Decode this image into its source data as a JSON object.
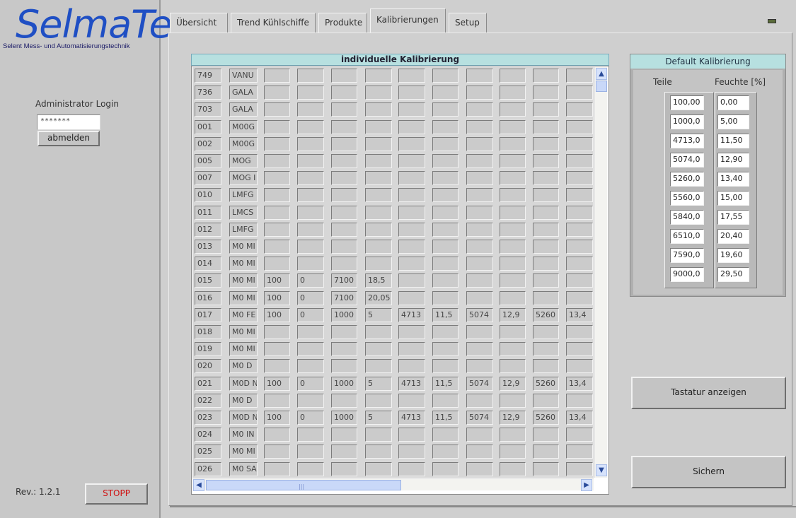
{
  "brand": {
    "logo_text": "SelmaTec",
    "subtitle": "Selent Mess- und Automatisierungstechnik",
    "logo_color": "#1f4fc4"
  },
  "sidebar": {
    "admin_label": "Administrator Login",
    "password_value": "*******",
    "logout_label": "abmelden",
    "revision": "Rev.: 1.2.1",
    "stop_label": "STOPP",
    "stop_color": "#d01010"
  },
  "tabs": [
    {
      "label": "Übersicht",
      "active": false
    },
    {
      "label": "Trend Kühlschiffe",
      "active": false
    },
    {
      "label": "Produkte",
      "active": false
    },
    {
      "label": "Kalibrierungen",
      "active": true
    },
    {
      "label": "Setup",
      "active": false
    }
  ],
  "table": {
    "title": "individuelle Kalibrierung",
    "header_color": "#b7e0e0",
    "rows": [
      [
        "749",
        "VANU",
        "",
        "",
        "",
        "",
        "",
        "",
        "",
        "",
        "",
        ""
      ],
      [
        "736",
        "GALA",
        "",
        "",
        "",
        "",
        "",
        "",
        "",
        "",
        "",
        ""
      ],
      [
        "703",
        "GALA",
        "",
        "",
        "",
        "",
        "",
        "",
        "",
        "",
        "",
        ""
      ],
      [
        "001",
        "M00G",
        "",
        "",
        "",
        "",
        "",
        "",
        "",
        "",
        "",
        ""
      ],
      [
        "002",
        "M00G",
        "",
        "",
        "",
        "",
        "",
        "",
        "",
        "",
        "",
        ""
      ],
      [
        "005",
        "MOG",
        "",
        "",
        "",
        "",
        "",
        "",
        "",
        "",
        "",
        ""
      ],
      [
        "007",
        "MOG I",
        "",
        "",
        "",
        "",
        "",
        "",
        "",
        "",
        "",
        ""
      ],
      [
        "010",
        "LMFG",
        "",
        "",
        "",
        "",
        "",
        "",
        "",
        "",
        "",
        ""
      ],
      [
        "011",
        "LMCS",
        "",
        "",
        "",
        "",
        "",
        "",
        "",
        "",
        "",
        ""
      ],
      [
        "012",
        "LMFG",
        "",
        "",
        "",
        "",
        "",
        "",
        "",
        "",
        "",
        ""
      ],
      [
        "013",
        "M0 MI",
        "",
        "",
        "",
        "",
        "",
        "",
        "",
        "",
        "",
        ""
      ],
      [
        "014",
        "M0 MI",
        "",
        "",
        "",
        "",
        "",
        "",
        "",
        "",
        "",
        ""
      ],
      [
        "015",
        "M0 MI",
        "100",
        "0",
        "7100",
        "18,5",
        "",
        "",
        "",
        "",
        "",
        ""
      ],
      [
        "016",
        "M0 MI",
        "100",
        "0",
        "7100",
        "20,05",
        "",
        "",
        "",
        "",
        "",
        ""
      ],
      [
        "017",
        "M0 FE",
        "100",
        "0",
        "1000",
        "5",
        "4713",
        "11,5",
        "5074",
        "12,9",
        "5260",
        "13,4"
      ],
      [
        "018",
        "M0 MI",
        "",
        "",
        "",
        "",
        "",
        "",
        "",
        "",
        "",
        ""
      ],
      [
        "019",
        "M0 MI",
        "",
        "",
        "",
        "",
        "",
        "",
        "",
        "",
        "",
        ""
      ],
      [
        "020",
        "M0 D",
        "",
        "",
        "",
        "",
        "",
        "",
        "",
        "",
        "",
        ""
      ],
      [
        "021",
        "M0D N",
        "100",
        "0",
        "1000",
        "5",
        "4713",
        "11,5",
        "5074",
        "12,9",
        "5260",
        "13,4"
      ],
      [
        "022",
        "M0 D",
        "",
        "",
        "",
        "",
        "",
        "",
        "",
        "",
        "",
        ""
      ],
      [
        "023",
        "M0D N",
        "100",
        "0",
        "1000",
        "5",
        "4713",
        "11,5",
        "5074",
        "12,9",
        "5260",
        "13,4"
      ],
      [
        "024",
        "M0 IN",
        "",
        "",
        "",
        "",
        "",
        "",
        "",
        "",
        "",
        ""
      ],
      [
        "025",
        "M0 MI",
        "",
        "",
        "",
        "",
        "",
        "",
        "",
        "",
        "",
        ""
      ],
      [
        "026",
        "M0 SA",
        "",
        "",
        "",
        "",
        "",
        "",
        "",
        "",
        "",
        ""
      ]
    ]
  },
  "default_calibration": {
    "title": "Default Kalibrierung",
    "col1_label": "Teile",
    "col2_label": "Feuchte [%]",
    "teile": [
      "100,00",
      "1000,0",
      "4713,0",
      "5074,0",
      "5260,0",
      "5560,0",
      "5840,0",
      "6510,0",
      "7590,0",
      "9000,0"
    ],
    "feuchte": [
      "0,00",
      "5,00",
      "11,50",
      "12,90",
      "13,40",
      "15,00",
      "17,55",
      "20,40",
      "19,60",
      "29,50"
    ]
  },
  "buttons": {
    "keyboard": "Tastatur anzeigen",
    "save": "Sichern"
  }
}
